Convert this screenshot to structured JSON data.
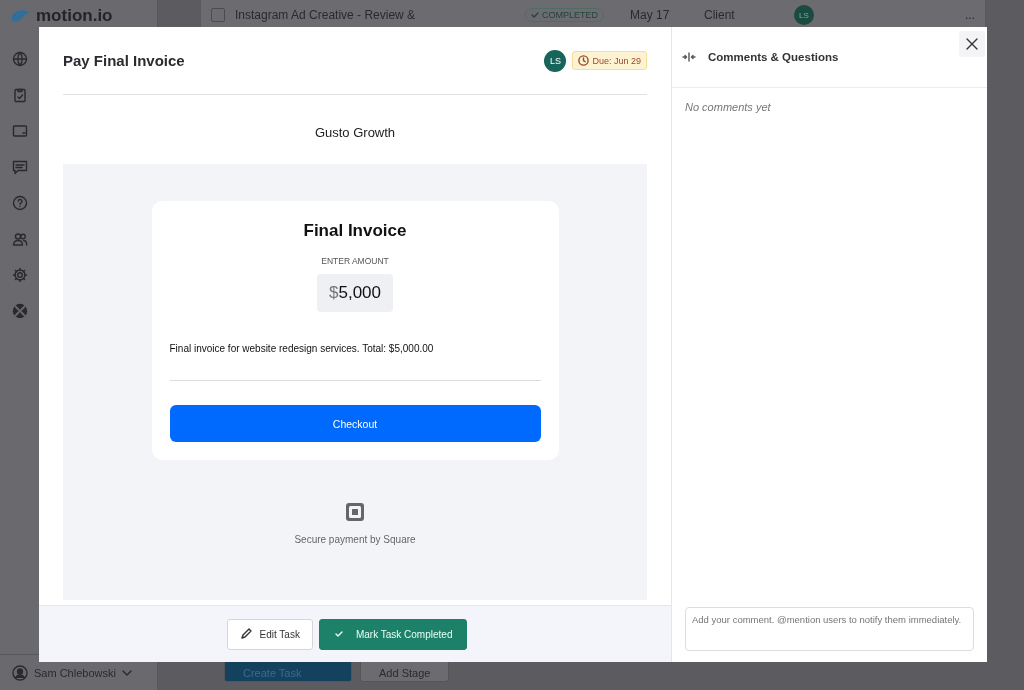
{
  "background_app": {
    "logo": "motion.io",
    "user": "Sam Chlebowski",
    "task_row": {
      "checked": false,
      "title": "Instagram Ad Creative - Review &",
      "status": "COMPLETED",
      "date": "May 17",
      "role": "Client",
      "avatar": "LS",
      "menu": "..."
    },
    "footer_buttons": [
      "Create Task",
      "Add Stage"
    ]
  },
  "modal": {
    "title": "Pay Final Invoice",
    "avatar": "LS",
    "due": "Due: Jun 29",
    "business": "Gusto Growth",
    "invoice": {
      "title": "Final Invoice",
      "amount_label": "ENTER AMOUNT",
      "currency": "$",
      "amount": "5,000",
      "description": "Final invoice for website redesign services. Total: $5,000.00",
      "button": "Checkout"
    },
    "secure_note": "Secure payment by Square",
    "buttons": [
      {
        "label": "Edit Task",
        "kind": "edit"
      },
      {
        "label": "Mark Task Completed",
        "kind": "complete"
      }
    ],
    "comments": {
      "title": "Comments & Questions",
      "empty": "No comments yet",
      "input_placeholder": "Add your comment. @mention users to notify them immediately."
    }
  }
}
